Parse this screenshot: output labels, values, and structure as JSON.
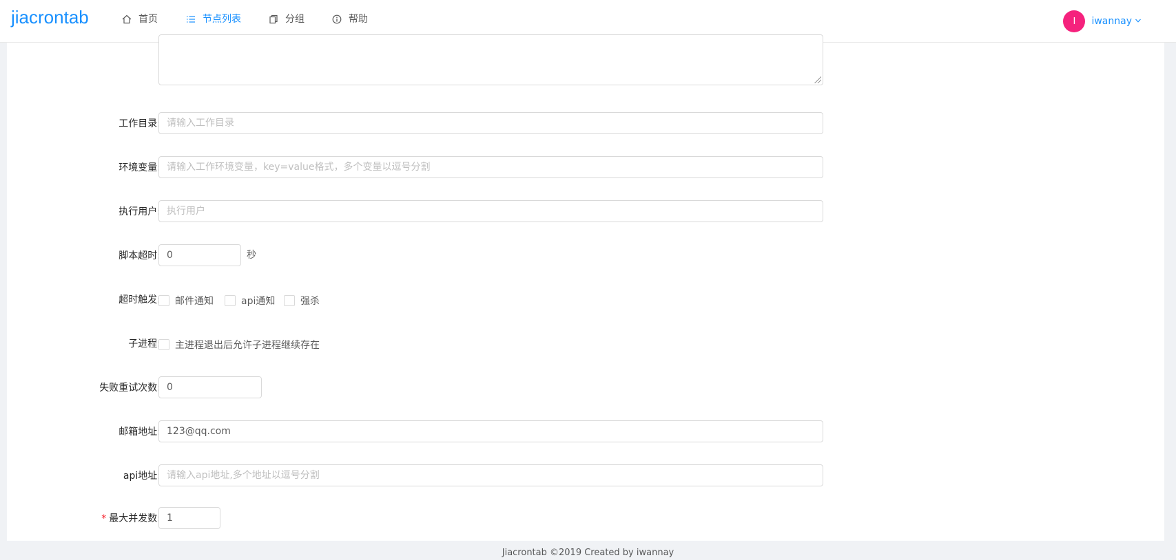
{
  "app": {
    "logo": "jiacrontab",
    "nav": [
      {
        "label": "首页",
        "icon": "home-icon"
      },
      {
        "label": "节点列表",
        "icon": "list-icon",
        "active": true
      },
      {
        "label": "分组",
        "icon": "copy-icon"
      },
      {
        "label": "帮助",
        "icon": "info-circle-icon"
      }
    ],
    "user": {
      "avatar_letter": "I",
      "name": "iwannay",
      "avatar_color": "#f5227d"
    }
  },
  "form": {
    "work_dir": {
      "label": "工作目录:",
      "placeholder": "请输入工作目录",
      "value": ""
    },
    "env": {
      "label": "环境变量:",
      "placeholder": "请输入工作环境变量，key=value格式，多个变量以逗号分割",
      "value": ""
    },
    "exec_user": {
      "label": "执行用户:",
      "placeholder": "执行用户",
      "value": ""
    },
    "timeout": {
      "label": "脚本超时:",
      "value": "0",
      "unit": "秒"
    },
    "timeout_trigger": {
      "label": "超时触发:",
      "options": [
        "邮件通知",
        "api通知",
        "强杀"
      ]
    },
    "child_process": {
      "label": "子进程:",
      "option": "主进程退出后允许子进程继续存在"
    },
    "retry": {
      "label": "失败重试次数:",
      "value": "0"
    },
    "email": {
      "label": "邮箱地址:",
      "value": "123@qq.com"
    },
    "api": {
      "label": "api地址:",
      "placeholder": "请输入api地址,多个地址以逗号分割",
      "value": ""
    },
    "max_concurrent": {
      "label": "最大并发数:",
      "value": "1",
      "required": true
    }
  },
  "footer": {
    "text": "Jiacrontab ©2019 Created by iwannay"
  },
  "colors": {
    "primary": "#1890ff",
    "required": "#f5222d"
  }
}
